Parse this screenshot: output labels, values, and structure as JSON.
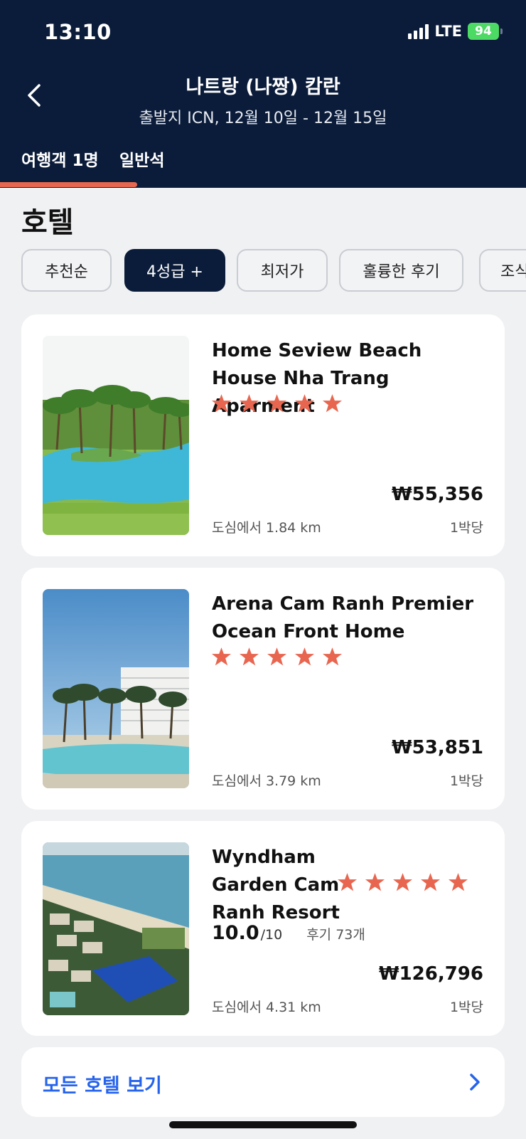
{
  "status_bar": {
    "time": "13:10",
    "network": "LTE",
    "battery": "94"
  },
  "header": {
    "title": "나트랑 (나짱) 캄란",
    "subtitle": "출발지 ICN, 12월 10일 - 12월 15일",
    "tabs": [
      {
        "label": "여행객 1명"
      },
      {
        "label": "일반석"
      }
    ],
    "accent_color": "#e8664f",
    "background_color": "#0b1c3a"
  },
  "section": {
    "title": "호텔"
  },
  "filters": [
    {
      "label": "추천순",
      "selected": false
    },
    {
      "label": "4성급 +",
      "selected": true
    },
    {
      "label": "최저가",
      "selected": false
    },
    {
      "label": "훌륭한 후기",
      "selected": false
    },
    {
      "label": "조식",
      "selected": false
    }
  ],
  "hotels": [
    {
      "name": "Home Seview Beach House Nha Trang Aparment",
      "stars": 5,
      "price": "₩55,356",
      "price_unit": "1박당",
      "distance": "도심에서 1.84 km"
    },
    {
      "name": "Arena Cam Ranh Premier Ocean Front Home",
      "stars": 5,
      "price": "₩53,851",
      "price_unit": "1박당",
      "distance": "도심에서 3.79 km"
    },
    {
      "name": "Wyndham Garden Cam Ranh Resort",
      "stars": 5,
      "rating": "10.0",
      "rating_max": "/10",
      "reviews": "후기 73개",
      "price": "₩126,796",
      "price_unit": "1박당",
      "distance": "도심에서 4.31 km"
    }
  ],
  "view_all": {
    "label": "모든 호텔 보기"
  },
  "colors": {
    "star": "#e8664f",
    "link": "#2563eb"
  },
  "icons": [
    "chevron-left-icon",
    "star-icon",
    "chevron-right-icon",
    "signal-icon",
    "battery-icon"
  ]
}
